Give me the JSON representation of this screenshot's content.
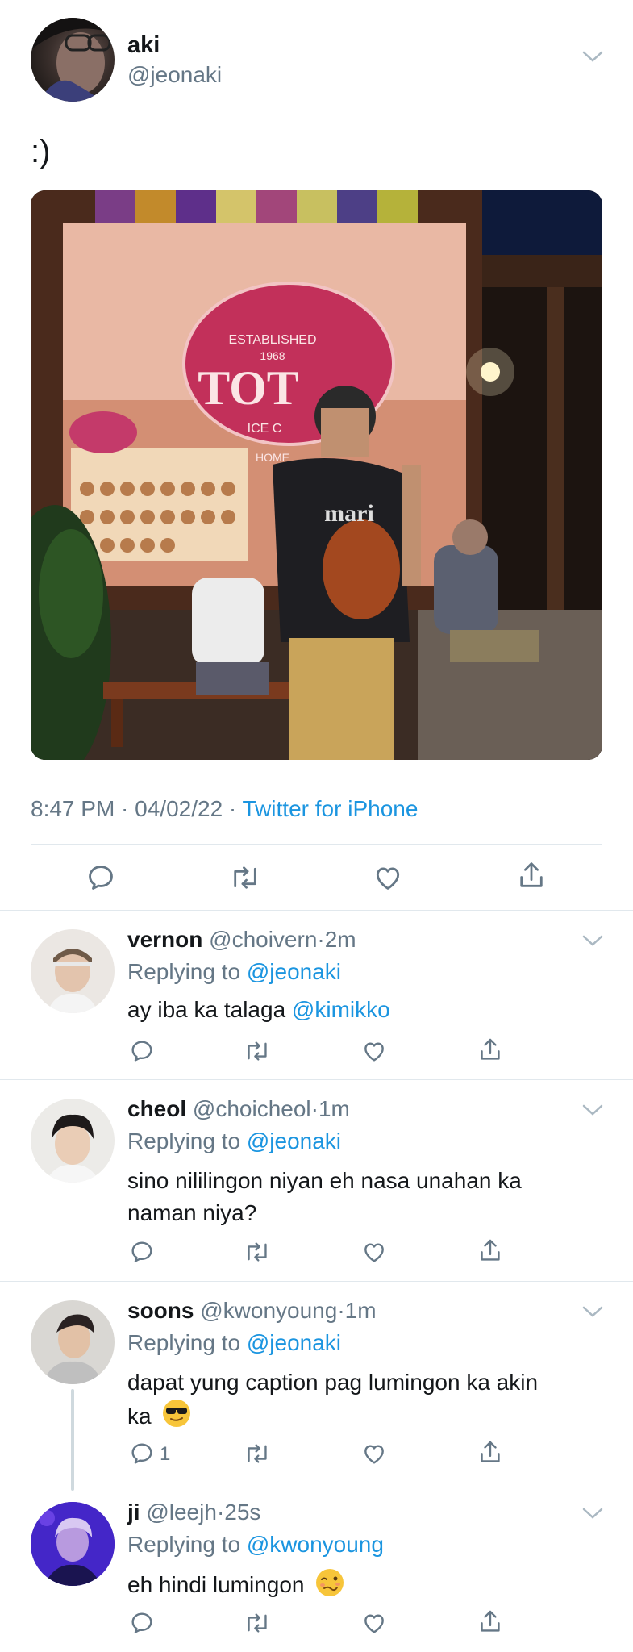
{
  "main_tweet": {
    "display_name": "aki",
    "handle": "@jeonaki",
    "text": ":)",
    "meta": {
      "time": "8:47 PM · 04/02/22 · ",
      "source": "Twitter for iPhone"
    },
    "photo": {
      "shop_sign": "TOT",
      "sign_top": "ESTABLISHED",
      "sign_year": "1968",
      "sign_mid": "ICE C",
      "sign_bottom": "HOME",
      "shirt_text": "mari"
    }
  },
  "replies": [
    {
      "display_name": "vernon",
      "handle": "@choivern",
      "time": "2m",
      "replying_prefix": "Replying to ",
      "replying_to": "@jeonaki",
      "text_line1": "ay iba ka talaga ",
      "mention": "@kimikko",
      "reply_count": ""
    },
    {
      "display_name": "cheol",
      "handle": "@choicheol",
      "time": "1m",
      "replying_prefix": "Replying to ",
      "replying_to": "@jeonaki",
      "text_line1": "sino nililingon niyan eh nasa unahan ka",
      "text_line2": "naman niya?",
      "reply_count": ""
    },
    {
      "display_name": "soons",
      "handle": "@kwonyoung",
      "time": "1m",
      "replying_prefix": "Replying to ",
      "replying_to": "@jeonaki",
      "text_line1": "dapat yung caption pag lumingon ka akin",
      "text_line2": "ka",
      "reply_count": "1"
    },
    {
      "display_name": "ji",
      "handle": "@leejh",
      "time": "25s",
      "replying_prefix": "Replying to ",
      "replying_to": "@kwonyoung",
      "text_line1": "eh hindi lumingon",
      "reply_count": ""
    }
  ],
  "colors": {
    "accent": "#1b95e0",
    "muted": "#657786",
    "divider": "#e1e8ed"
  },
  "icons": {
    "reply": "speech-bubble",
    "retweet": "retweet-arrows",
    "like": "heart",
    "share": "upload-arrow",
    "more": "chevron-down"
  }
}
